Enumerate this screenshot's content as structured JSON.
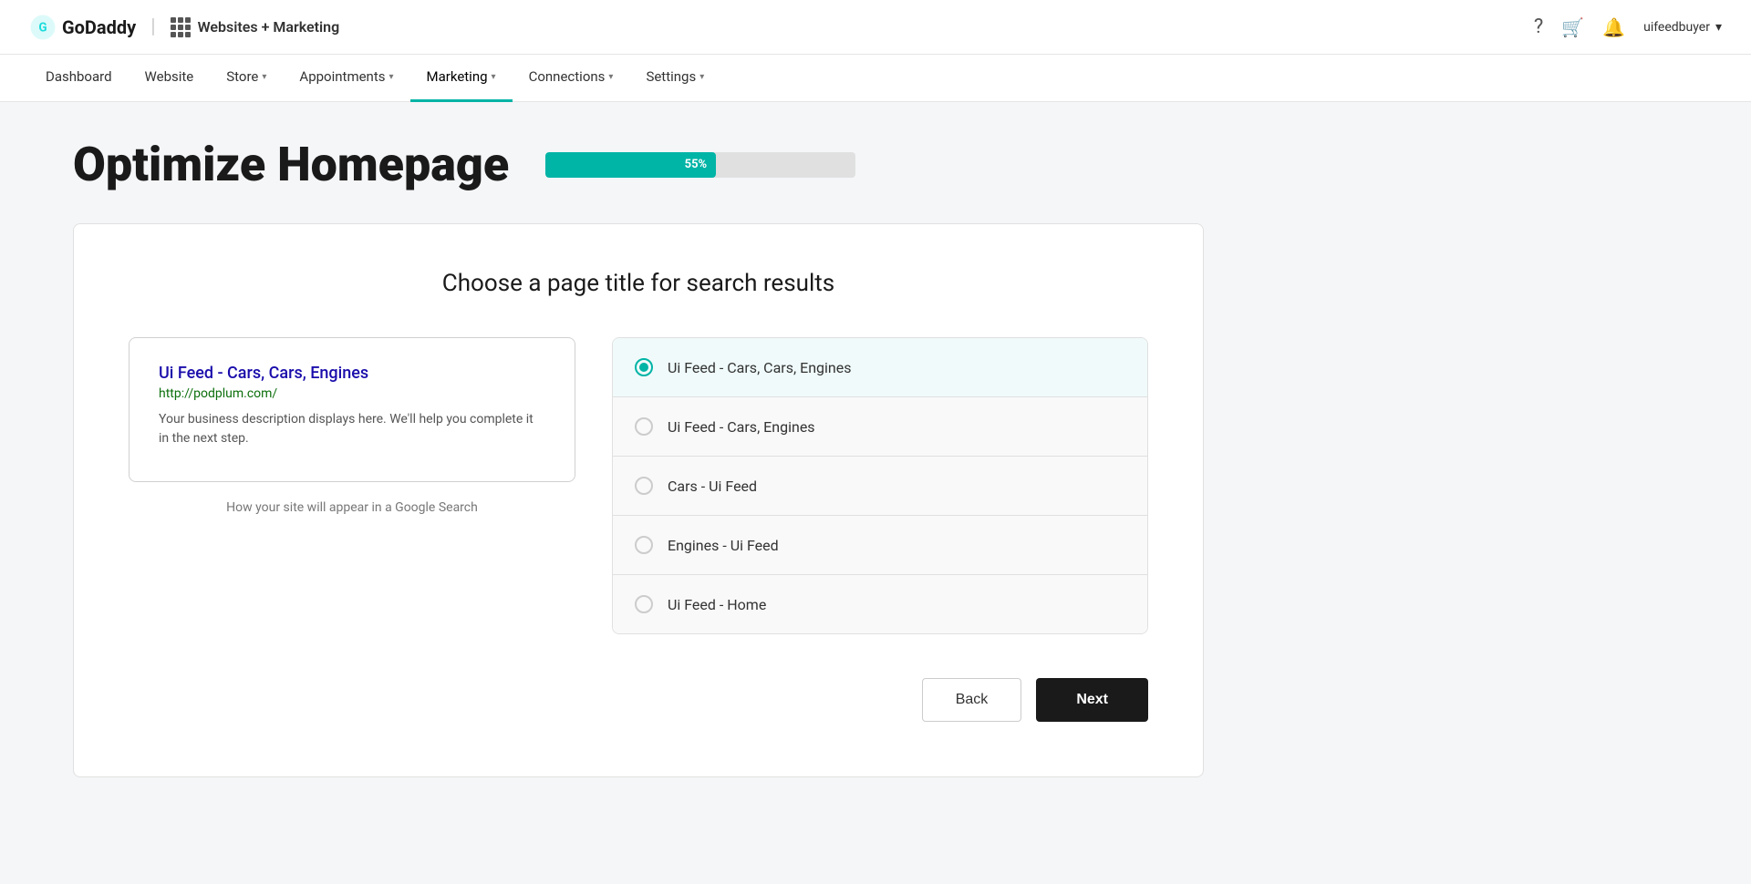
{
  "topbar": {
    "logo_text": "GoDaddy",
    "divider": "|",
    "product_name": "Websites + Marketing",
    "icons": {
      "help": "?",
      "cart": "🛒",
      "bell": "🔔"
    },
    "user_name": "uifeedbuyer",
    "chevron": "▾"
  },
  "nav": {
    "items": [
      {
        "label": "Dashboard",
        "active": false,
        "has_chevron": false
      },
      {
        "label": "Website",
        "active": false,
        "has_chevron": false
      },
      {
        "label": "Store",
        "active": false,
        "has_chevron": true
      },
      {
        "label": "Appointments",
        "active": false,
        "has_chevron": true
      },
      {
        "label": "Marketing",
        "active": true,
        "has_chevron": true
      },
      {
        "label": "Connections",
        "active": false,
        "has_chevron": true
      },
      {
        "label": "Settings",
        "active": false,
        "has_chevron": true
      }
    ]
  },
  "page": {
    "title": "Optimize Homepage",
    "progress": {
      "percent": 55,
      "label": "55%",
      "bar_width_pct": 55
    }
  },
  "card": {
    "title": "Choose a page title for search results",
    "preview": {
      "title_link": "Ui Feed - Cars, Cars, Engines",
      "url": "http://podplum.com/",
      "description": "Your business description displays here. We'll help you complete it in the next step.",
      "caption": "How your site will appear in a Google Search"
    },
    "options": [
      {
        "label": "Ui Feed - Cars, Cars, Engines",
        "selected": true
      },
      {
        "label": "Ui Feed - Cars, Engines",
        "selected": false
      },
      {
        "label": "Cars - Ui Feed",
        "selected": false
      },
      {
        "label": "Engines - Ui Feed",
        "selected": false
      },
      {
        "label": "Ui Feed - Home",
        "selected": false
      }
    ]
  },
  "buttons": {
    "back_label": "Back",
    "next_label": "Next"
  }
}
